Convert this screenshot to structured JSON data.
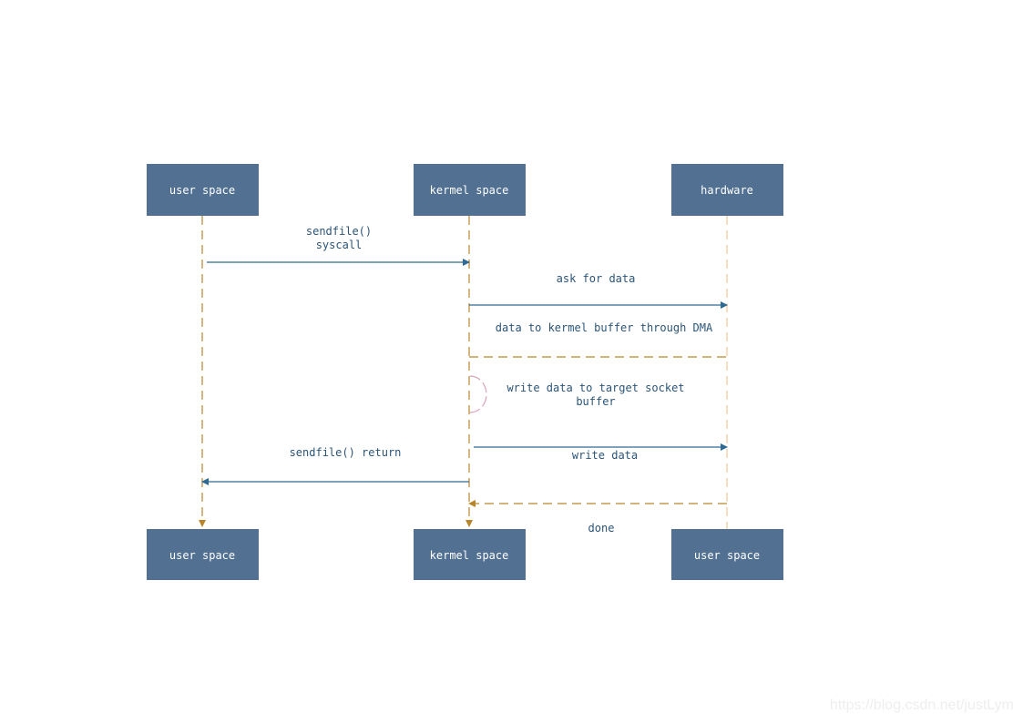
{
  "diagram": {
    "type": "sequence",
    "participants_top": [
      {
        "id": "user",
        "label": "user space"
      },
      {
        "id": "kernel",
        "label": "kermel space"
      },
      {
        "id": "hardware",
        "label": "hardware"
      }
    ],
    "participants_bottom": [
      {
        "id": "user",
        "label": "user space"
      },
      {
        "id": "kernel",
        "label": "kermel space"
      },
      {
        "id": "hardware",
        "label": "user space"
      }
    ],
    "messages": [
      {
        "id": "sendfile-syscall",
        "from": "user",
        "to": "kernel",
        "style": "solid",
        "label_lines": [
          "sendfile()",
          "syscall"
        ]
      },
      {
        "id": "ask-for-data",
        "from": "kernel",
        "to": "hardware",
        "style": "solid",
        "label_lines": [
          "ask for data"
        ]
      },
      {
        "id": "dma-copy",
        "from": "hardware",
        "to": "kernel",
        "style": "dashed-no-head",
        "label_lines": [
          "data to kermel buffer through DMA"
        ]
      },
      {
        "id": "self-write",
        "from": "kernel",
        "to": "kernel",
        "style": "self-arc",
        "label_lines": [
          "write data to target socket",
          "buffer"
        ]
      },
      {
        "id": "write-data",
        "from": "kernel",
        "to": "hardware",
        "style": "solid",
        "label_lines": [
          "write data"
        ]
      },
      {
        "id": "sendfile-return",
        "from": "kernel",
        "to": "user",
        "style": "solid",
        "label_lines": [
          "sendfile() return"
        ]
      },
      {
        "id": "done",
        "from": "hardware",
        "to": "kernel",
        "style": "dashed",
        "label_lines": [
          "done"
        ]
      }
    ],
    "colors": {
      "box": "#517092",
      "box_text": "#ffffff",
      "message_text": "#2b5478",
      "message_line": "#2e6a94",
      "lifeline_dark": "#b8862a",
      "lifeline_light": "#f2c894",
      "return_dashed": "#b8862a",
      "self_arc": "#d8a2bc"
    }
  },
  "watermark": "https://blog.csdn.net/justLym"
}
